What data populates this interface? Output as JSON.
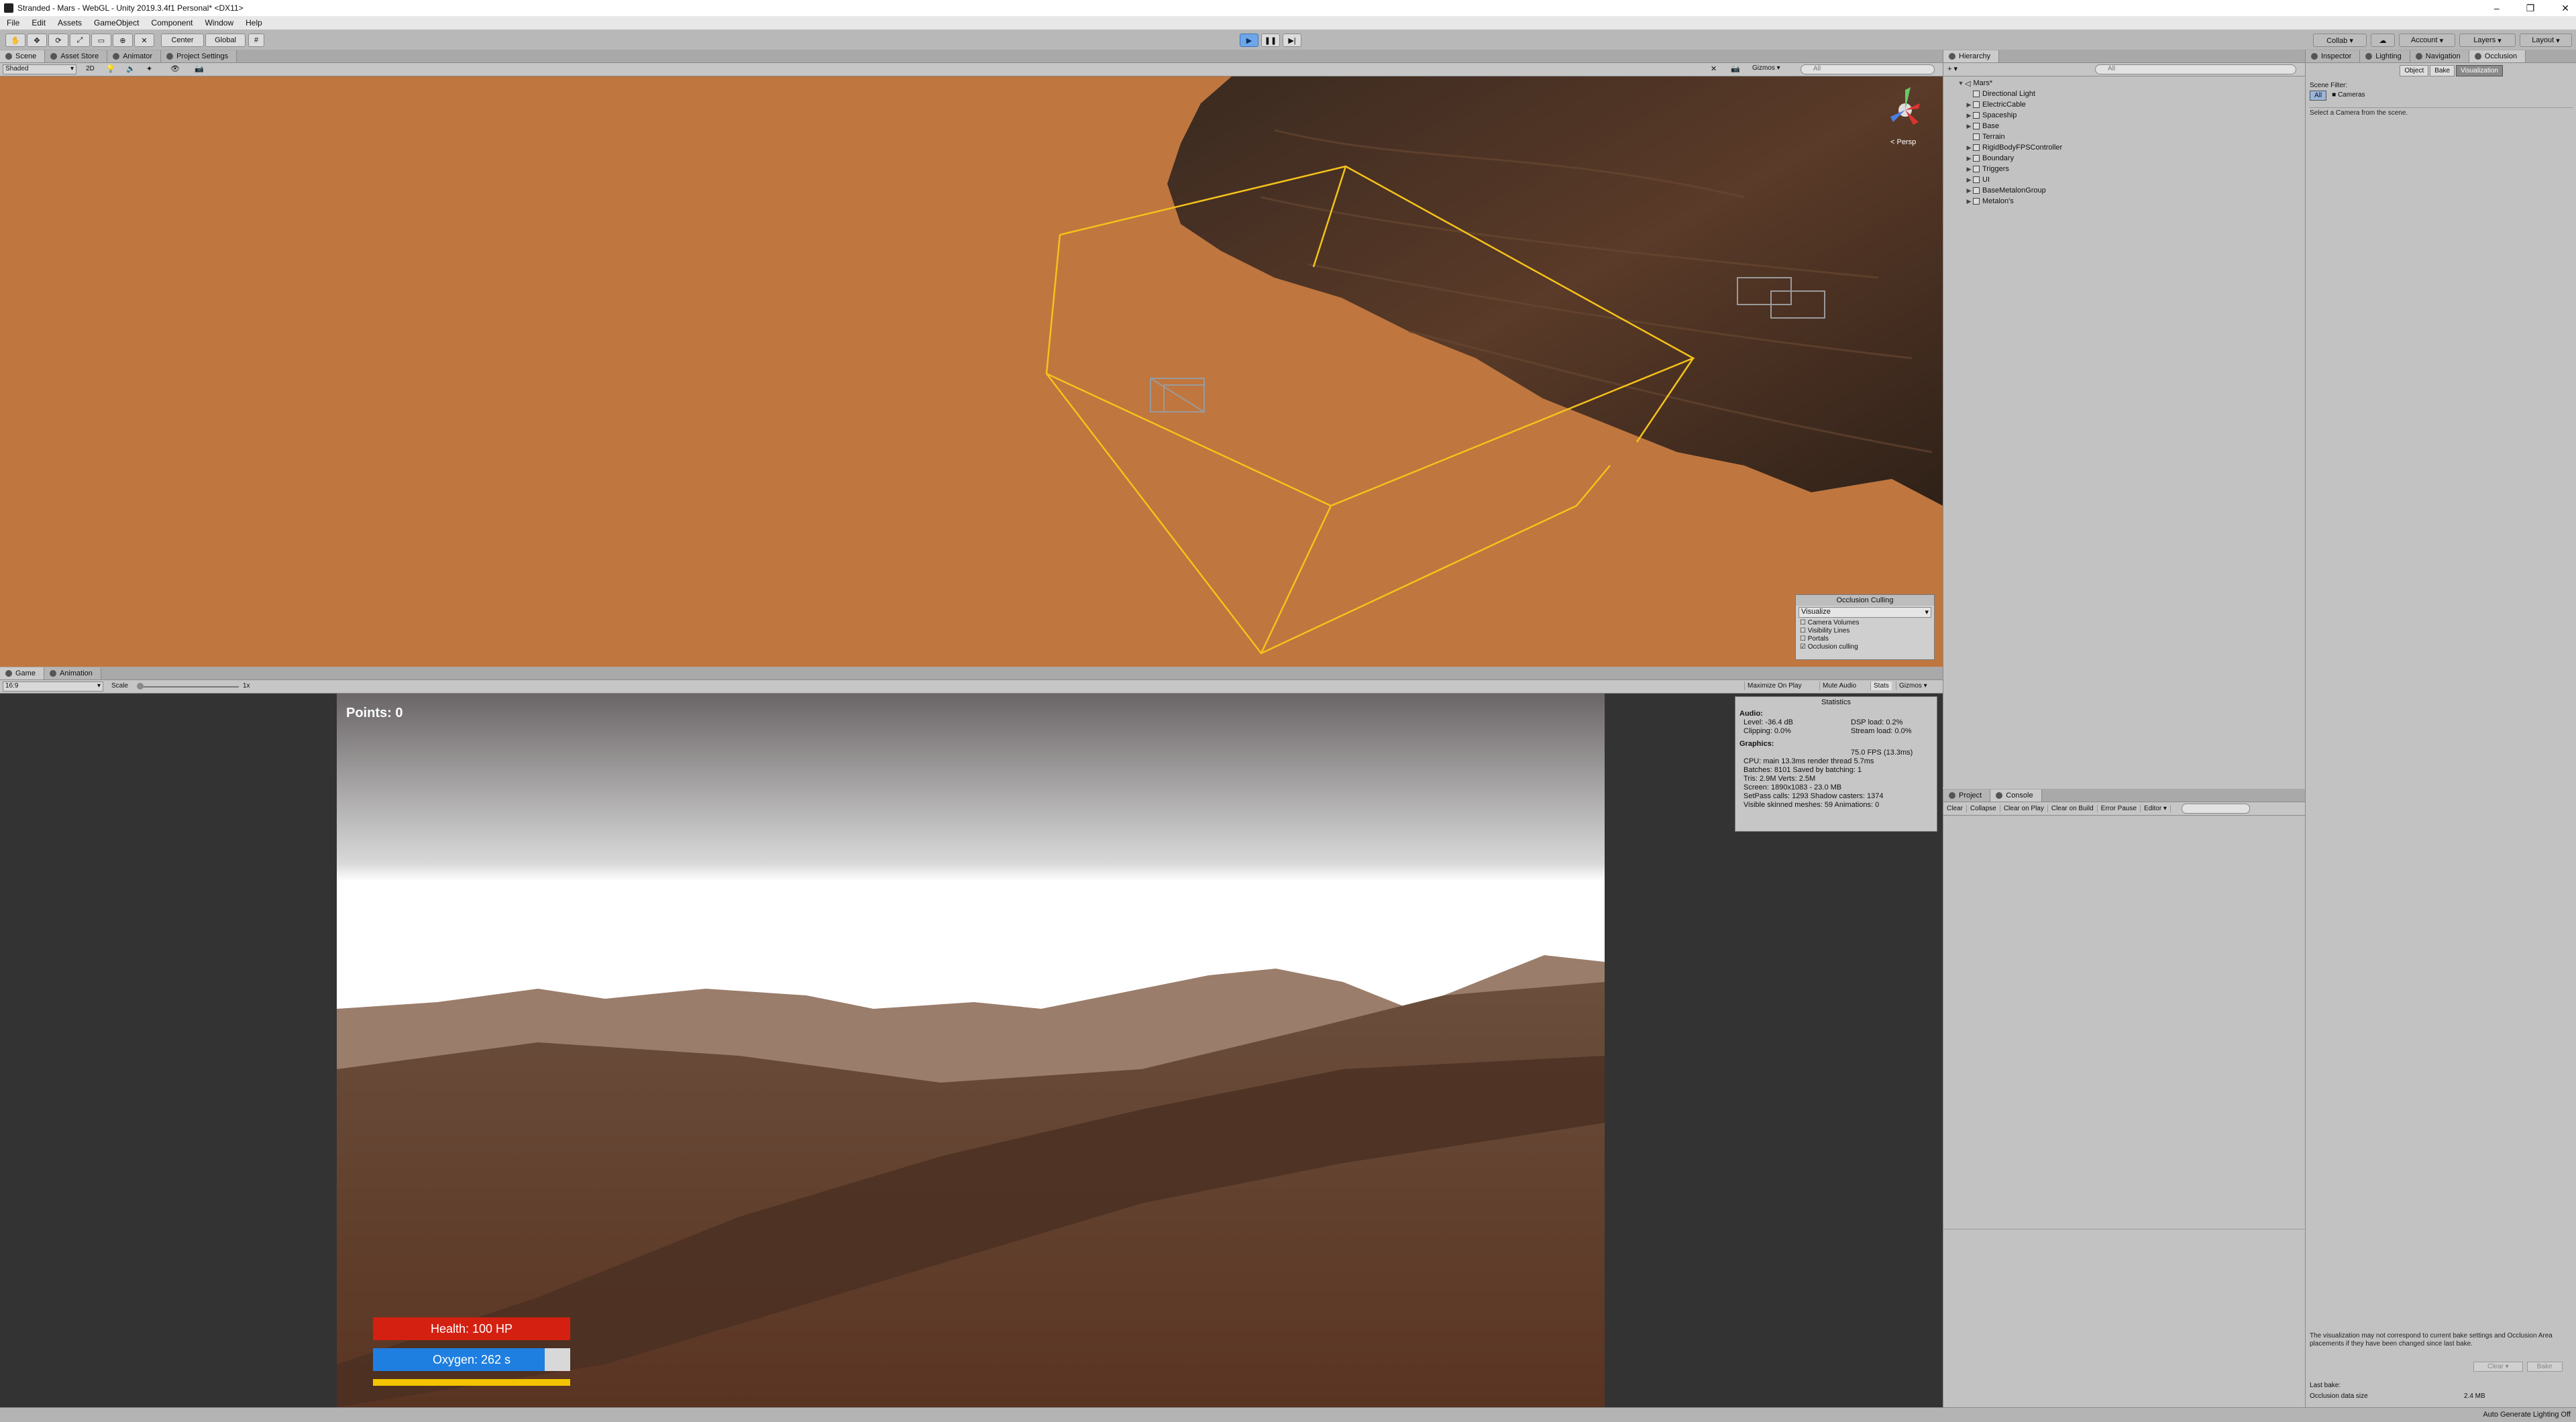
{
  "window": {
    "title": "Stranded - Mars - WebGL - Unity 2019.3.4f1 Personal* <DX11>",
    "controls": [
      "–",
      "❐",
      "✕"
    ]
  },
  "menu": [
    "File",
    "Edit",
    "Assets",
    "GameObject",
    "Component",
    "Window",
    "Help"
  ],
  "toolbar": {
    "pivot": "Center",
    "space": "Global",
    "collab": "Collab ▾",
    "account": "Account",
    "layers": "Layers",
    "layout": "Layout"
  },
  "scene_tabs": [
    "Scene",
    "Asset Store",
    "Animator",
    "Project Settings"
  ],
  "scene_toolbar": {
    "shading": "Shaded",
    "gizmos": "Gizmos",
    "search_placeholder": "All",
    "persp_label": "< Persp"
  },
  "occlusion_overlay": {
    "title": "Occlusion Culling",
    "mode": "Visualize",
    "options": [
      {
        "label": "Camera Volumes",
        "checked": false
      },
      {
        "label": "Visibility Lines",
        "checked": false
      },
      {
        "label": "Portals",
        "checked": false
      },
      {
        "label": "Occlusion culling",
        "checked": true
      }
    ]
  },
  "game_tabs": [
    "Game",
    "Animation"
  ],
  "game_toolbar": {
    "aspect": "16:9",
    "scale_label": "Scale",
    "scale_value": "1x",
    "maximize": "Maximize On Play",
    "mute": "Mute Audio",
    "stats": "Stats",
    "gizmos": "Gizmos"
  },
  "hud": {
    "points": "Points: 0",
    "health": "Health: 100 HP",
    "oxygen": "Oxygen: 262 s",
    "oxygen_fraction": 0.87,
    "health_color": "#d42010",
    "oxygen_color": "#1e7fe0",
    "stamina_color": "#f5c400"
  },
  "statistics": {
    "title": "Statistics",
    "audio_heading": "Audio:",
    "level": "Level: -36.4 dB",
    "clipping": "Clipping: 0.0%",
    "dsp": "DSP load: 0.2%",
    "stream": "Stream load: 0.0%",
    "graphics_heading": "Graphics:",
    "fps": "75.0 FPS (13.3ms)",
    "cpu": "CPU: main 13.3ms  render thread 5.7ms",
    "batches": "Batches: 8101   Saved by batching: 1",
    "tris": "Tris: 2.9M        Verts: 2.5M",
    "screen": "Screen: 1890x1083 - 23.0 MB",
    "setpass": "SetPass calls: 1293      Shadow casters: 1374",
    "skinned": "Visible skinned meshes: 59   Animations: 0"
  },
  "hierarchy": {
    "tab": "Hierarchy",
    "search_placeholder": "All",
    "root": "Mars*",
    "items": [
      "Directional Light",
      "ElectricCable",
      "Spaceship",
      "Base",
      "Terrain",
      "RigidBodyFPSController",
      "Boundary",
      "Triggers",
      "UI",
      "BaseMetalonGroup",
      "Metalon's"
    ]
  },
  "console": {
    "tabs": [
      "Project",
      "Console"
    ],
    "buttons": [
      "Clear",
      "Collapse",
      "Clear on Play",
      "Clear on Build",
      "Error Pause",
      "Editor ▾"
    ]
  },
  "inspector": {
    "tabs": [
      "Inspector",
      "Lighting",
      "Navigation",
      "Occlusion"
    ],
    "mode_buttons": [
      "Object",
      "Bake",
      "Visualization"
    ],
    "scene_filter_label": "Scene Filter:",
    "filter_all": "All",
    "filter_cameras": "Cameras",
    "hint": "Select a Camera from the scene.",
    "warning": "The visualization may not correspond to current bake settings and Occlusion Area placements if they have been changed since last bake.",
    "clear": "Clear",
    "bake": "Bake",
    "last_bake": "Last bake:",
    "data_size_label": "Occlusion data size",
    "data_size_value": "2.4 MB"
  },
  "status": {
    "right": "Auto Generate Lighting Off"
  }
}
